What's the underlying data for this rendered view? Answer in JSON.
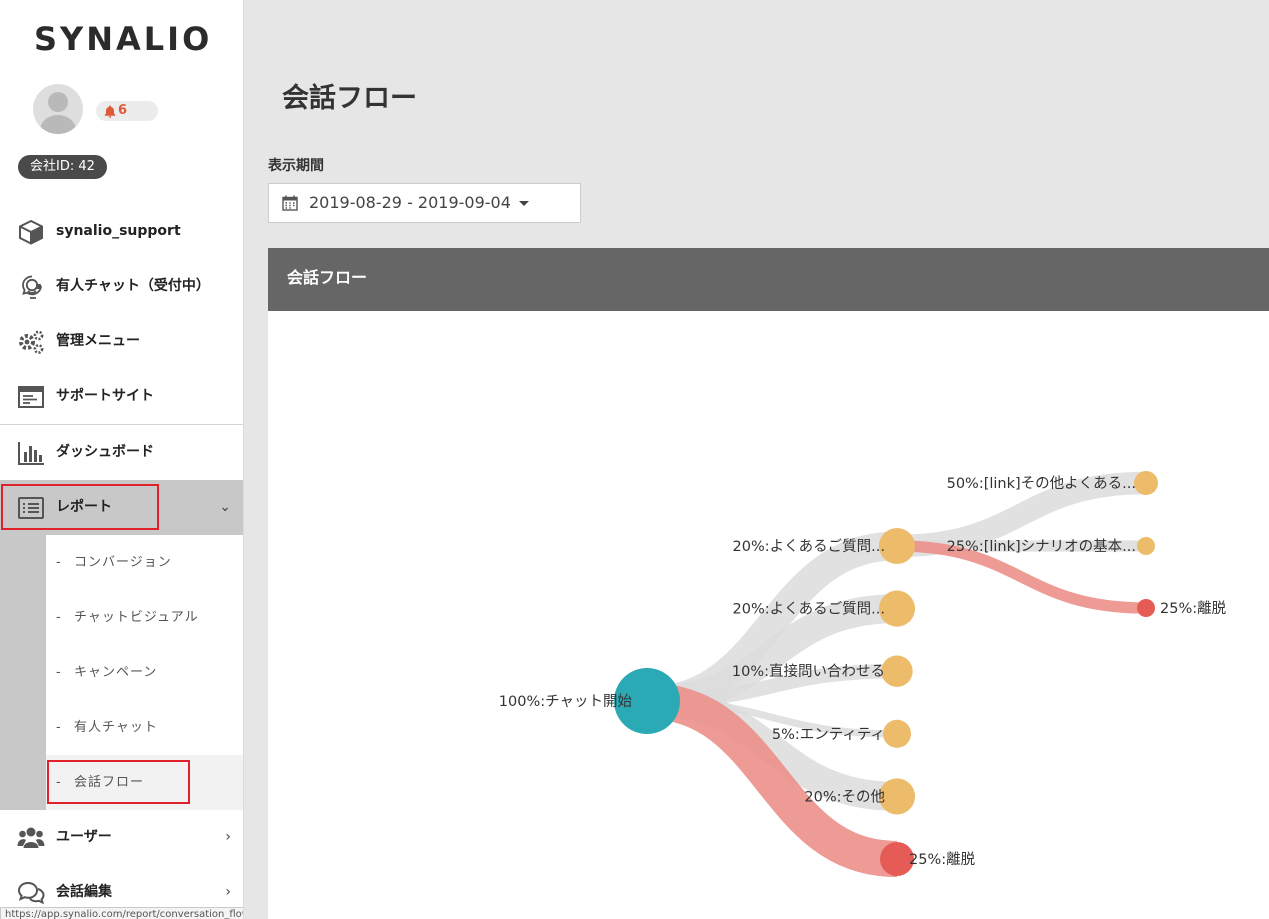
{
  "sidebar": {
    "logo": "SYNALIO",
    "notification_count": "6",
    "company_badge": "会社ID: 42",
    "nav": [
      {
        "label": "synalio_support",
        "icon": "cube-icon"
      },
      {
        "label": "有人チャット（受付中）",
        "icon": "headset-icon"
      },
      {
        "label": "管理メニュー",
        "icon": "gears-icon"
      },
      {
        "label": "サポートサイト",
        "icon": "browser-window-icon"
      },
      {
        "label": "ダッシュボード",
        "icon": "bar-chart-icon"
      },
      {
        "label": "レポート",
        "icon": "list-icon",
        "expanded": true
      },
      {
        "label": "ユーザー",
        "icon": "users-icon"
      },
      {
        "label": "会話編集",
        "icon": "chat-bubbles-icon"
      }
    ],
    "report_sub": [
      {
        "label": "コンバージョン"
      },
      {
        "label": "チャットビジュアル"
      },
      {
        "label": "キャンペーン"
      },
      {
        "label": "有人チャット"
      },
      {
        "label": "会話フロー",
        "active": true
      }
    ],
    "status_url": "https://app.synalio.com/report/conversation_flow"
  },
  "main": {
    "page_title": "会話フロー",
    "period_label": "表示期間",
    "date_range": "2019-08-29 - 2019-09-04",
    "panel_title": "会話フロー"
  },
  "colors": {
    "root_node": "#2ba9b4",
    "node": "#ecbc6a",
    "exit_node": "#e45c55",
    "link": "#dcdcdc",
    "exit_link": "#ec8f8a",
    "panel_header": "#666666"
  },
  "flow": {
    "root": {
      "label": "100%:チャット開始",
      "percent": 100
    },
    "level1": [
      {
        "label": "20%:よくあるご質問...",
        "percent": 20,
        "type": "normal"
      },
      {
        "label": "20%:よくあるご質問...",
        "percent": 20,
        "type": "normal"
      },
      {
        "label": "10%:直接問い合わせる",
        "percent": 10,
        "type": "normal"
      },
      {
        "label": "5%:エンティティ",
        "percent": 5,
        "type": "normal"
      },
      {
        "label": "20%:その他",
        "percent": 20,
        "type": "normal"
      },
      {
        "label": "25%:離脱",
        "percent": 25,
        "type": "exit"
      }
    ],
    "level2": [
      {
        "label": "50%:[link]その他よくある...",
        "percent": 50,
        "type": "normal"
      },
      {
        "label": "25%:[link]シナリオの基本...",
        "percent": 25,
        "type": "normal"
      },
      {
        "label": "25%:離脱",
        "percent": 25,
        "type": "exit"
      }
    ]
  }
}
